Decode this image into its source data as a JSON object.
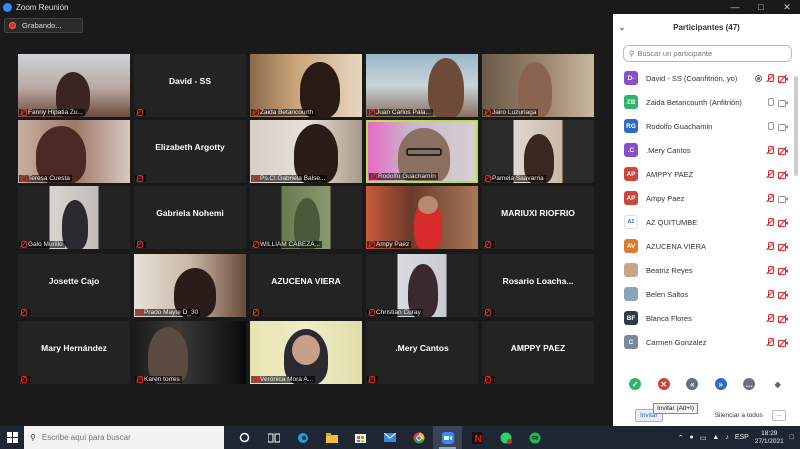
{
  "window": {
    "title": "Zoom Reunión"
  },
  "recording": {
    "label": "Grabando..."
  },
  "tiles": [
    {
      "label": "Fanny Hipatia Zu..."
    },
    {
      "name": "David - SS"
    },
    {
      "label": "Zaida Betancourth"
    },
    {
      "label": "Juan Carlos Pala..."
    },
    {
      "label": "Jairo Luzuriaga"
    },
    {
      "label": "Teresa Cuesta"
    },
    {
      "name": "Elizabeth Argotty"
    },
    {
      "label": "Ps.Cl.Gabriela Balse..."
    },
    {
      "label": "Rodolfo Guachamín"
    },
    {
      "label": "Pamela Saavarria"
    },
    {
      "label": "Galo Murillo"
    },
    {
      "name": "Gabriela Nohemi"
    },
    {
      "label": "WILLIAM CABEZA..."
    },
    {
      "label": "Ampy Paez"
    },
    {
      "name": "MARIUXI RIOFRIO"
    },
    {
      "name": "Josette Cajo"
    },
    {
      "label": "Prado Mayte D_30"
    },
    {
      "name": "AZUCENA VIERA"
    },
    {
      "label": "Christian Curay"
    },
    {
      "name": "Rosario  Loacha..."
    },
    {
      "name": "Mary Hernández"
    },
    {
      "label": "Karen torres"
    },
    {
      "label": "Verónica Mora A..."
    },
    {
      "name": ".Mery Cantos"
    },
    {
      "name": "AMPPY PAEZ"
    }
  ],
  "panel": {
    "title": "Participantes (47)",
    "search_placeholder": "Buscar un participante",
    "participants": [
      {
        "initials": "D-",
        "name": "David - SS (Coanfitrión, yo)",
        "color": "#8a4fc8"
      },
      {
        "initials": "ZB",
        "name": "Zaida Betancourth (Anfitrión)",
        "color": "#2fb36b"
      },
      {
        "initials": "RG",
        "name": "Rodolfo Guachamin",
        "color": "#2d6cc0"
      },
      {
        "initials": ".C",
        "name": ".Mery Cantos",
        "color": "#8a4fc8"
      },
      {
        "initials": "AP",
        "name": "AMPPY PAEZ",
        "color": "#d0443a"
      },
      {
        "initials": "AP",
        "name": "Ampy Paez",
        "color": "#d0443a"
      },
      {
        "initials": "",
        "name": "AZ QUITUMBE",
        "color": "#ffffff"
      },
      {
        "initials": "AV",
        "name": "AZUCENA VIERA",
        "color": "#e07a2a"
      },
      {
        "initials": "",
        "name": "Beatriz Reyes",
        "color": "#c9a58a"
      },
      {
        "initials": "",
        "name": "Belen Saltos",
        "color": "#8aa4b8"
      },
      {
        "initials": "BF",
        "name": "Blanca Flores",
        "color": "#333a45"
      },
      {
        "initials": "C",
        "name": "Carmen Gonzalez",
        "color": "#7a8a9a"
      }
    ],
    "invite_label": "Invitar",
    "invite_tooltip": "Invitar (Alt+I)",
    "mute_all_label": "Silenciar a todos",
    "more_label": "..."
  },
  "taskbar": {
    "search_placeholder": "Escribe aquí para buscar",
    "lang": "ESP",
    "time": "18:29",
    "date": "27/1/2021"
  }
}
